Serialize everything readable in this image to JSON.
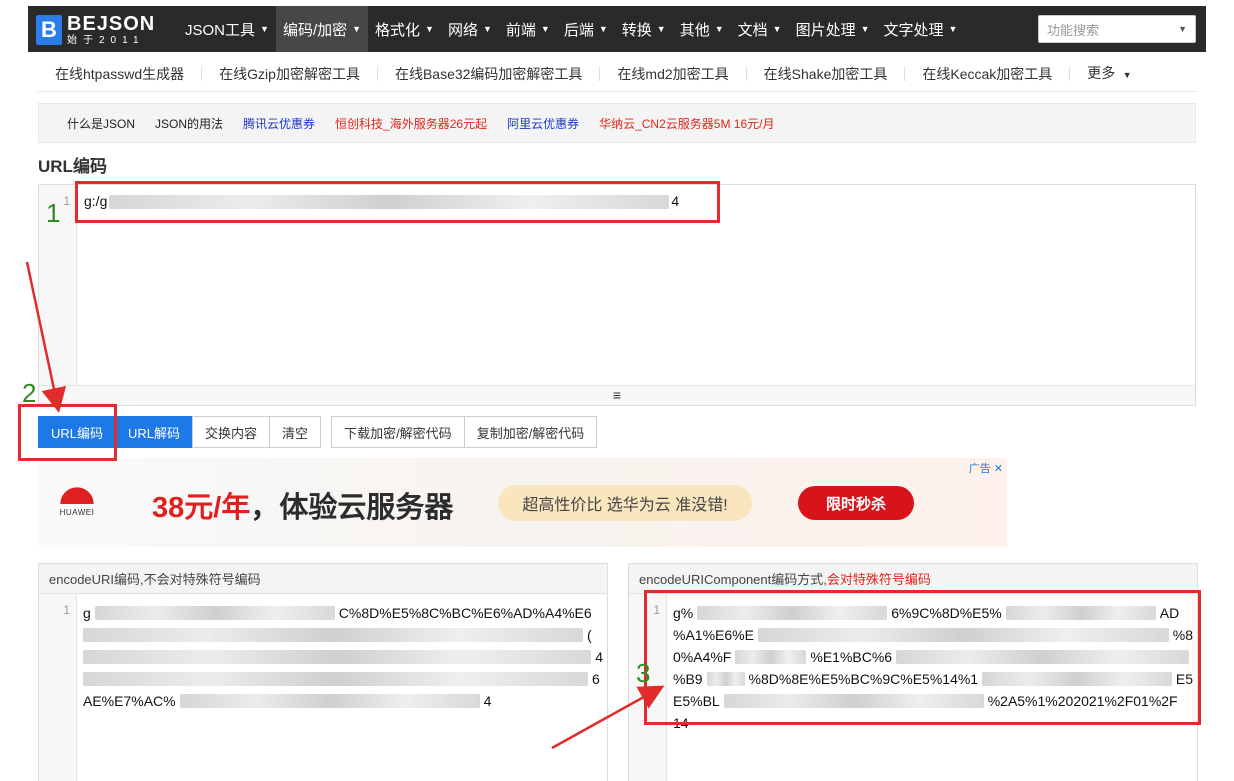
{
  "header": {
    "logo_name": "BEJSON",
    "logo_sub": "始于2011",
    "nav": [
      {
        "label": "JSON工具",
        "active": false
      },
      {
        "label": "编码/加密",
        "active": true
      },
      {
        "label": "格式化",
        "active": false
      },
      {
        "label": "网络",
        "active": false
      },
      {
        "label": "前端",
        "active": false
      },
      {
        "label": "后端",
        "active": false
      },
      {
        "label": "转换",
        "active": false
      },
      {
        "label": "其他",
        "active": false
      },
      {
        "label": "文档",
        "active": false
      },
      {
        "label": "图片处理",
        "active": false
      },
      {
        "label": "文字处理",
        "active": false
      }
    ],
    "search_placeholder": "功能搜索"
  },
  "tools": [
    "在线htpasswd生成器",
    "在线Gzip加密解密工具",
    "在线Base32编码加密解密工具",
    "在线md2加密工具",
    "在线Shake加密工具",
    "在线Keccak加密工具",
    "更多"
  ],
  "infobar": [
    {
      "label": "什么是JSON",
      "style": "dark"
    },
    {
      "label": "JSON的用法",
      "style": "dark"
    },
    {
      "label": "腾讯云优惠券",
      "style": "blue"
    },
    {
      "label": "恒创科技_海外服务器26元起",
      "style": "red"
    },
    {
      "label": "阿里云优惠券",
      "style": "blue"
    },
    {
      "label": "华纳云_CN2云服务器5M 16元/月",
      "style": "red"
    }
  ],
  "page_title": "URL编码",
  "editor": {
    "line_number": "1",
    "visible_prefix": "g:/g",
    "visible_suffix": "4"
  },
  "buttons": {
    "encode": "URL编码",
    "decode": "URL解码",
    "swap": "交换内容",
    "clear": "清空",
    "download": "下载加密/解密代码",
    "copy": "复制加密/解密代码"
  },
  "ad": {
    "tag": "广告",
    "close": "✕",
    "brand": "HUAWEI",
    "price": "38元/年",
    "headline": "，体验云服务器",
    "pill": "超高性价比 选华为云 准没错!",
    "cta": "限时秒杀"
  },
  "result_left": {
    "title": "encodeURI编码,不会对特殊符号编码",
    "line_number": "1",
    "lines": [
      {
        "pre": "g",
        "post": "C%8D%E5%8C%BC%E6%AD%A4%E6"
      },
      {
        "pre": "",
        "post": "("
      },
      {
        "pre": "",
        "post": "4"
      },
      {
        "pre": "",
        "post": "6"
      },
      {
        "pre": "AE%E7%AC%",
        "post": "4"
      }
    ]
  },
  "result_right": {
    "title": "encodeURIComponent编码方式,",
    "title_note": "会对特殊符号编码",
    "line_number": "1",
    "lines": [
      {
        "pre": "g%",
        "post": "6%9C%8D%E5%",
        "tail": "AD"
      },
      {
        "pre": "%A1%E6%E",
        "post": "",
        "tail": "%8"
      },
      {
        "pre": "0%A4%F",
        "post": "%E1%BC%6",
        "tail": ""
      },
      {
        "pre": "%B9",
        "post": "%8D%8E%E5%BC%9C%E5%14%1",
        "tail": "E5"
      },
      {
        "pre": "E5%BL",
        "post": "",
        "tail": "%2A5%1%202021%2F01%2F"
      },
      {
        "pre": "14",
        "post": "",
        "tail": ""
      }
    ]
  },
  "annotations": {
    "n1": "1",
    "n2": "2",
    "n3": "3"
  },
  "colors": {
    "primary": "#1e78e6",
    "annotation_red": "#e22b2b",
    "annotation_green": "#2e8b22",
    "nav_bg": "#2a2a2a"
  }
}
